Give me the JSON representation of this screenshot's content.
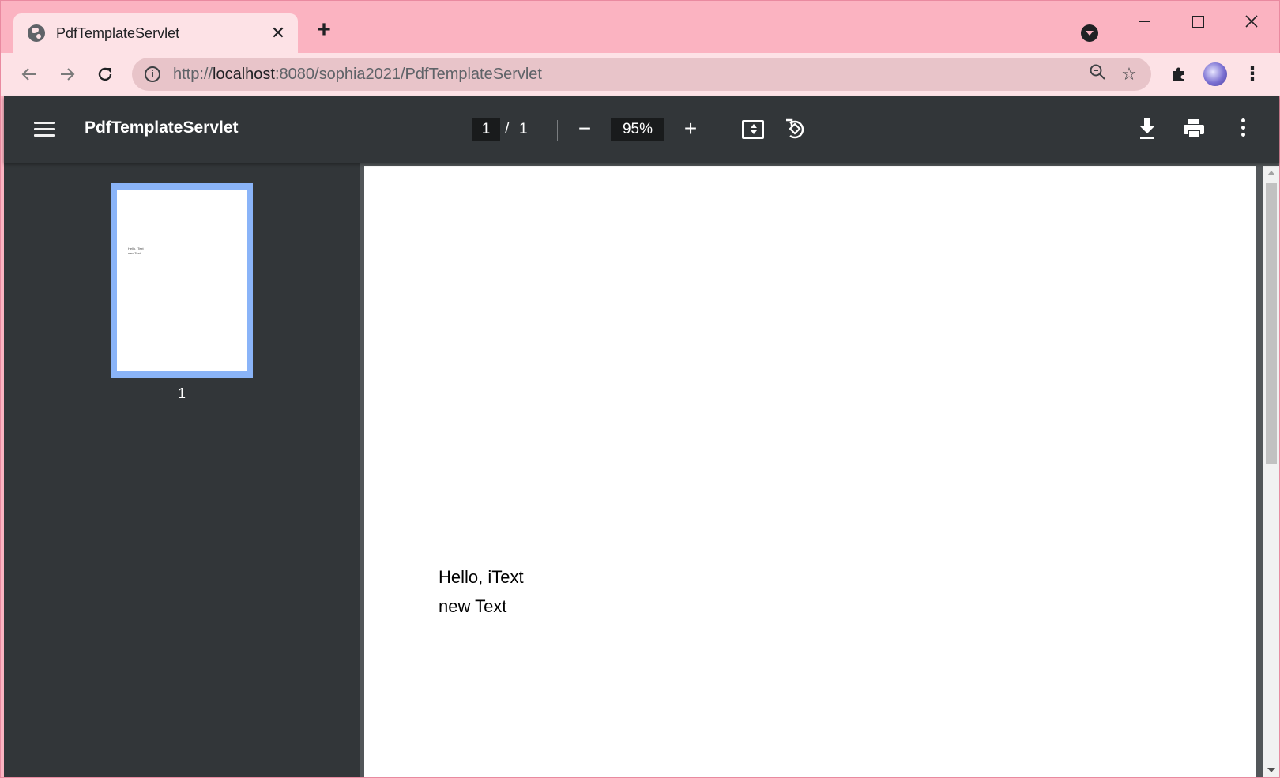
{
  "browser": {
    "tab": {
      "title": "PdfTemplateServlet",
      "close_label": "✕"
    },
    "new_tab_label": "+",
    "url_prefix": "http://",
    "url_host": "localhost",
    "url_rest": ":8080/sophia2021/PdfTemplateServlet"
  },
  "pdf_viewer": {
    "title": "PdfTemplateServlet",
    "current_page": "1",
    "page_separator": "/",
    "total_pages": "1",
    "zoom": "95%",
    "zoom_out_label": "−",
    "zoom_in_label": "+",
    "thumbnail_label": "1",
    "page_lines": [
      "Hello, iText",
      "new Text"
    ]
  },
  "colors": {
    "frame": "#fbb3c1",
    "toolbar": "#fde2e6",
    "pdf_toolbar": "#323639",
    "thumbnail_highlight": "#8ab4f8"
  }
}
